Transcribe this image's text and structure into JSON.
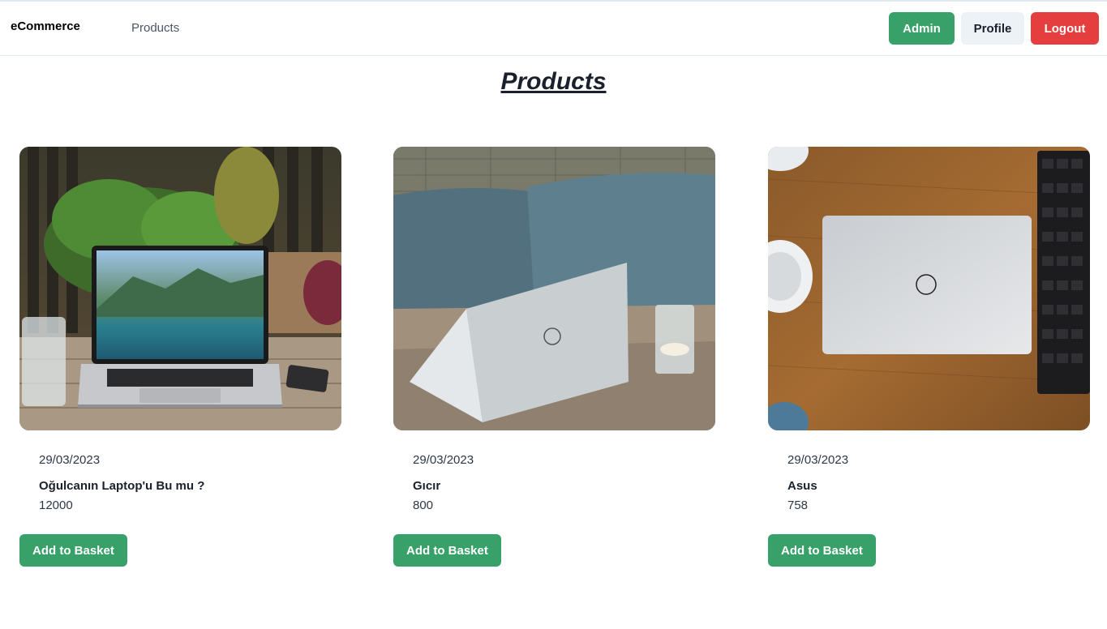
{
  "navbar": {
    "brand": "eCommerce",
    "products_link": "Products",
    "admin_label": "Admin",
    "profile_label": "Profile",
    "logout_label": "Logout"
  },
  "page": {
    "title": "Products"
  },
  "products": [
    {
      "date": "29/03/2023",
      "name": "Oğulcanın Laptop'u Bu mu ?",
      "price": "12000",
      "button": "Add to Basket",
      "image": "macbook-on-outdoor-table"
    },
    {
      "date": "29/03/2023",
      "name": "Gıcır",
      "price": "800",
      "button": "Add to Basket",
      "image": "dell-laptop-back-view"
    },
    {
      "date": "29/03/2023",
      "name": "Asus",
      "price": "758",
      "button": "Add to Basket",
      "image": "dell-laptop-top-view-on-desk"
    }
  ],
  "colors": {
    "success": "#38a169",
    "danger": "#e53e3e",
    "neutral": "#edf2f7"
  }
}
